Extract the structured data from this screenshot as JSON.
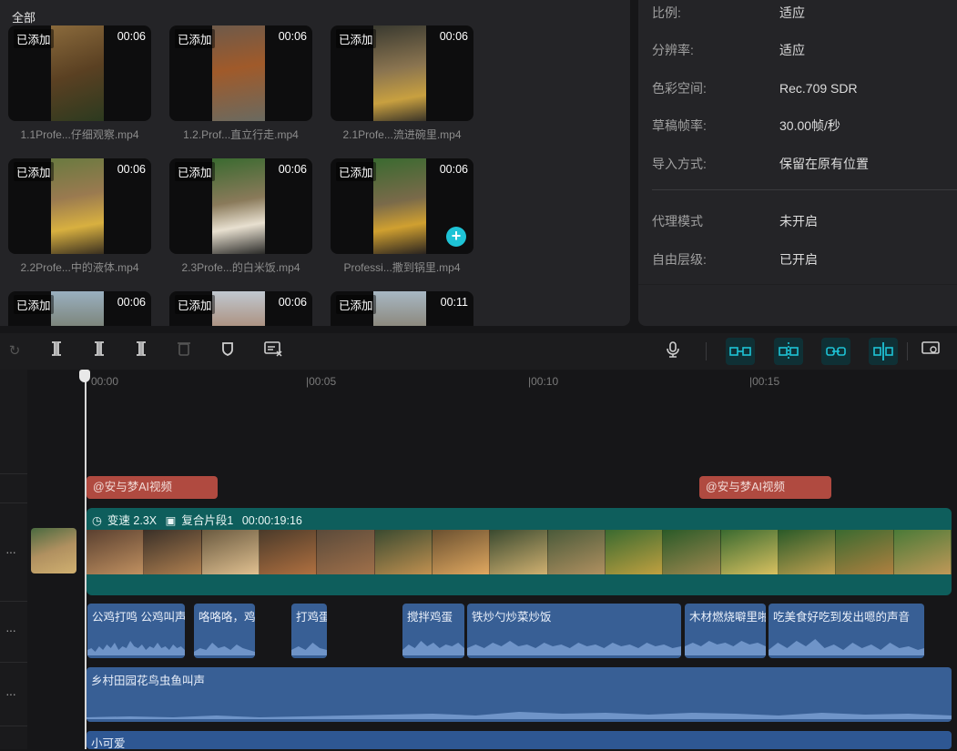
{
  "media": {
    "section_label": "全部",
    "added_tag": "已添加",
    "items": [
      {
        "duration": "00:06",
        "filename": "1.1Profe...仔细观察.mp4"
      },
      {
        "duration": "00:06",
        "filename": "1.2.Prof...直立行走.mp4"
      },
      {
        "duration": "00:06",
        "filename": "2.1Profe...流进碗里.mp4"
      },
      {
        "duration": "00:06",
        "filename": "2.2Profe...中的液体.mp4"
      },
      {
        "duration": "00:06",
        "filename": "2.3Profe...的白米饭.mp4"
      },
      {
        "duration": "00:06",
        "filename": "Professi...撒到锅里.mp4"
      },
      {
        "duration": "00:06",
        "filename": ""
      },
      {
        "duration": "00:06",
        "filename": ""
      },
      {
        "duration": "00:11",
        "filename": ""
      }
    ]
  },
  "properties": [
    {
      "label": "比例:",
      "value": "适应"
    },
    {
      "label": "分辨率:",
      "value": "适应"
    },
    {
      "label": "色彩空间:",
      "value": "Rec.709 SDR"
    },
    {
      "label": "草稿帧率:",
      "value": "30.00帧/秒"
    },
    {
      "label": "导入方式:",
      "value": "保留在原有位置"
    },
    {
      "label": "代理模式",
      "value": "未开启"
    },
    {
      "label": "自由层级:",
      "value": "已开启"
    }
  ],
  "ruler": {
    "ticks": [
      "00:00",
      "|00:05",
      "|00:10",
      "|00:15"
    ]
  },
  "tracks": {
    "text_clips": [
      "@安与梦AI视频",
      "@安与梦AI视频"
    ],
    "main_clip": {
      "speed": "变速 2.3X",
      "compound": "复合片段1",
      "duration": "00:00:19:16"
    },
    "sfx_clips": [
      "公鸡打鸣 公鸡叫声",
      "咯咯咯，鸡",
      "打鸡蛋",
      "搅拌鸡蛋",
      "铁炒勺炒菜炒饭",
      "木材燃烧噼里啪",
      "吃美食好吃到发出嗯的声音"
    ],
    "ambient_clip": "乡村田园花鸟虫鱼叫声",
    "music_clip": "小可爱"
  },
  "colors": {
    "accent": "#1ec3d6",
    "text_clip": "#b04a40",
    "main_clip": "#0e5e5c",
    "audio_clip": "#385f95"
  }
}
